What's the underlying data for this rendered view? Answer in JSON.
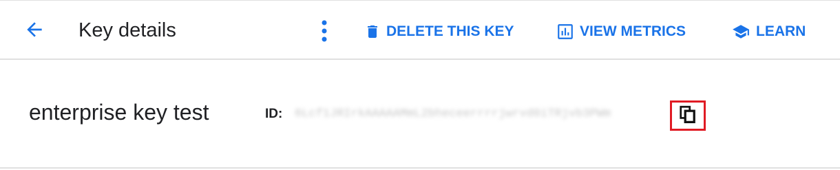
{
  "header": {
    "title": "Key details",
    "back_icon": "arrow-back-icon",
    "more_icon": "more-vert-icon",
    "actions": {
      "delete": {
        "label": "DELETE THIS KEY",
        "icon": "trash-icon"
      },
      "metrics": {
        "label": "VIEW METRICS",
        "icon": "bar-chart-icon"
      },
      "learn": {
        "label": "LEARN",
        "icon": "graduation-cap-icon"
      }
    }
  },
  "key": {
    "name": "enterprise key test",
    "id_label": "ID:",
    "id_value": "6Lcf1JRIrkAAAAAMmL2bheceerrrrjwrvd0iTRjvb3PWm",
    "copy_icon": "copy-icon"
  },
  "colors": {
    "accent": "#1a73e8",
    "text": "#202124",
    "divider": "#e0e0e0",
    "highlight": "#e01b24"
  }
}
